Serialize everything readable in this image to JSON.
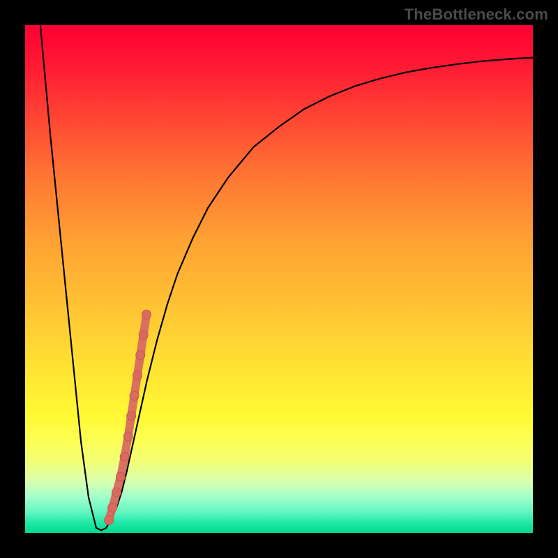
{
  "watermark": "TheBottleneck.com",
  "colors": {
    "curve_stroke": "#000000",
    "marker_fill": "#d86a60",
    "marker_stroke": "#c9584f",
    "gradient_top": "#ff0033",
    "gradient_bottom": "#00d98c"
  },
  "chart_data": {
    "type": "line",
    "title": "",
    "xlabel": "",
    "ylabel": "",
    "xlim": [
      0,
      100
    ],
    "ylim": [
      0,
      100
    ],
    "grid": false,
    "legend": false,
    "series": [
      {
        "name": "bottleneck-curve",
        "x": [
          3,
          5,
          7,
          9,
          11,
          12.5,
          14,
          15,
          16,
          17,
          18,
          19,
          20,
          22,
          24,
          26,
          28,
          30,
          33,
          36,
          40,
          45,
          50,
          55,
          60,
          65,
          70,
          75,
          80,
          85,
          90,
          95,
          100
        ],
        "y": [
          100,
          78,
          58,
          38,
          18,
          7,
          1,
          0.5,
          1,
          3,
          5,
          8,
          12,
          21,
          30,
          38,
          45,
          51,
          58,
          64,
          70,
          76,
          80,
          83.5,
          86,
          88,
          89.5,
          90.7,
          91.6,
          92.3,
          92.9,
          93.3,
          93.6
        ]
      }
    ],
    "markers": {
      "name": "highlighted-points",
      "x": [
        16.5,
        17.2,
        18.0,
        18.8,
        19.6,
        20.3,
        20.9,
        21.5,
        22.1,
        22.7,
        23.3,
        23.9
      ],
      "y": [
        2.5,
        5,
        8,
        11,
        15,
        19,
        23,
        27,
        31,
        35,
        39,
        43
      ]
    }
  }
}
